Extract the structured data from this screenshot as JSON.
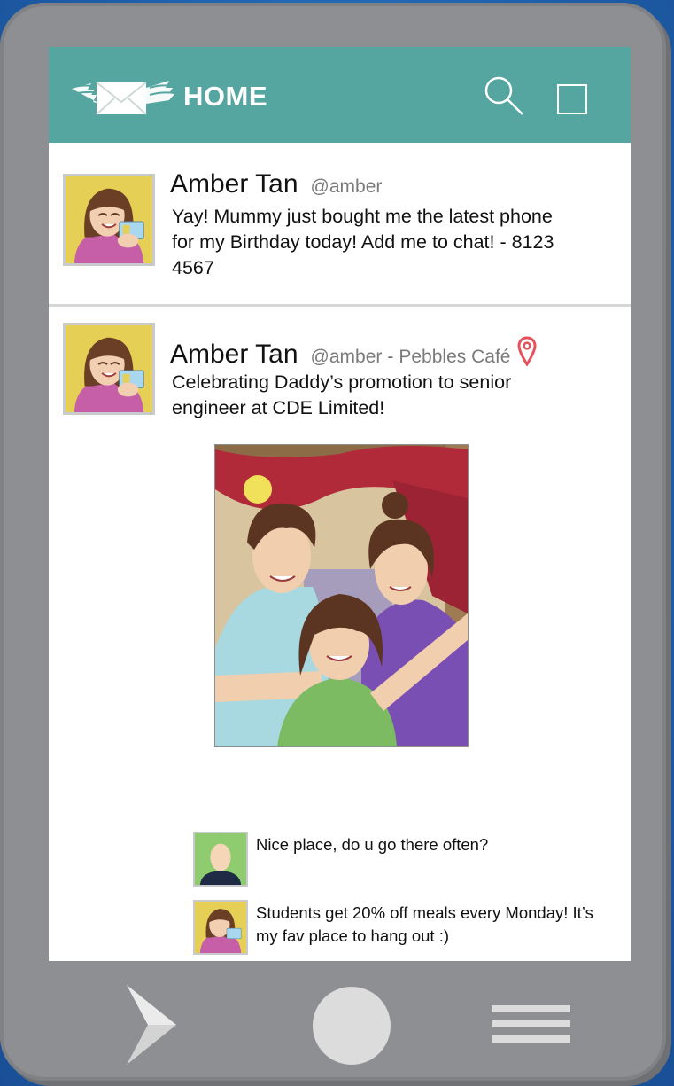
{
  "appbar": {
    "title": "HOME",
    "color": "#55a5a1",
    "icons": [
      "winged-envelope-logo",
      "search-icon",
      "square-icon"
    ]
  },
  "feed": [
    {
      "name": "Amber Tan",
      "handle": "@amber",
      "text": "Yay! Mummy just bought me the latest phone for my Birthday today! Add me to chat! - 8123 4567"
    },
    {
      "name": "Amber Tan",
      "handle": "@amber",
      "separator": "-",
      "location": "Pebbles Café",
      "text": "Celebrating Daddy’s promotion to senior engineer at CDE Limited!",
      "comments": [
        {
          "text": "Nice place, do u go there often?"
        },
        {
          "text": "Students get 20% off meals every Monday! It’s my fav place to hang out :)"
        }
      ]
    }
  ],
  "nav": {
    "icons": [
      "back-chevron-icon",
      "home-circle-icon",
      "menu-lines-icon"
    ]
  },
  "colors": {
    "background": "#1f64b0",
    "phone": "#8d8f92",
    "pin": "#e8505b"
  }
}
